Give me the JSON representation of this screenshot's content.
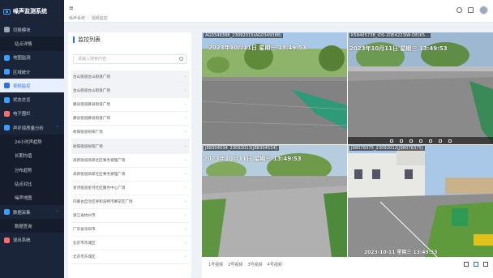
{
  "sidebar": {
    "brand": "噪声监测系统",
    "items": [
      {
        "label": "切换模块",
        "icon": "grid-icon",
        "color": "#9aa4b5",
        "kind": "top"
      },
      {
        "label": "站点详情",
        "kind": "sub"
      },
      {
        "label": "地图监测",
        "icon": "map-icon",
        "color": "#3aa0ff",
        "kind": "top"
      },
      {
        "label": "区域统计",
        "icon": "chart-icon",
        "color": "#3aa0ff",
        "kind": "top"
      },
      {
        "label": "视频监控",
        "icon": "camera-icon",
        "color": "#2f6fe0",
        "kind": "active"
      },
      {
        "label": "状态总览",
        "icon": "monitor-icon",
        "color": "#3aa0ff",
        "kind": "top"
      },
      {
        "label": "电子围栏",
        "icon": "fence-icon",
        "color": "#ff6b6b",
        "kind": "top"
      },
      {
        "label": "声环境质量分析",
        "icon": "wave-icon",
        "color": "#3aa0ff",
        "kind": "top",
        "caret": "⌃"
      },
      {
        "label": "24小时声趋势",
        "kind": "sub"
      },
      {
        "label": "长期均值",
        "kind": "sub"
      },
      {
        "label": "分布趋势",
        "kind": "sub"
      },
      {
        "label": "站点对比",
        "kind": "sub"
      },
      {
        "label": "噪声地图",
        "kind": "sub"
      },
      {
        "label": "数据采集",
        "icon": "data-icon",
        "color": "#3aa0ff",
        "kind": "top",
        "caret": "⌃"
      },
      {
        "label": "数据查询",
        "kind": "sub"
      },
      {
        "label": "退出系统",
        "icon": "logout-icon",
        "color": "#ff6b6b",
        "kind": "top"
      }
    ]
  },
  "header": {
    "menu_glyph": "≡",
    "breadcrumb": [
      "噪声系统",
      "视频监控"
    ],
    "breadcrumb_sep": "/"
  },
  "panel": {
    "title": "监控列表",
    "search_placeholder": "请输入搜索内容",
    "items": [
      {
        "label": "台山街道台山街道广场",
        "grey": true
      },
      {
        "label": "台山街道台山街道广场",
        "grey": true
      },
      {
        "label": "藤县街道藤县街道广场",
        "grey": false
      },
      {
        "label": "藤县街道藤县街道广场",
        "grey": false
      },
      {
        "label": "射阳街道射阳广场",
        "grey": false
      },
      {
        "label": "射阳街道射阳广场",
        "grey": true
      },
      {
        "label": "高新街道高新社区事务受理广场",
        "grey": false
      },
      {
        "label": "高新街道高新社区事务受理广场",
        "grey": false
      },
      {
        "label": "星河街道星河社区服务中心广场",
        "grey": false
      },
      {
        "label": "内蒙古自治区呼和浩特市赛罕区广场",
        "grey": false
      },
      {
        "label": "浙江省杭州市",
        "grey": false
      },
      {
        "label": "广东省深圳市",
        "grey": false
      },
      {
        "label": "北京市东城区",
        "grey": false
      },
      {
        "label": "北京市东城区",
        "grey": false
      }
    ],
    "chevron": "›"
  },
  "videos": {
    "cells": [
      {
        "label": "AG0349388_23092015(AG0349388)",
        "ts": "2023年10月11日 星期三 13:49:53"
      },
      {
        "label": "K58405738_iDS-2DE4223IW-DE(K5...",
        "ts": "2023年10月11日 星期三 13:49:53"
      },
      {
        "label": "J88304534_23092013(J88304534)",
        "ts": "2023年10月11日 星期三 13:49:53"
      },
      {
        "label": "J98078375_23092012(J98078375)",
        "ts": "2023-10-11 星期三 13:49:53"
      }
    ],
    "tabs": [
      "1号视频",
      "2号视频",
      "3号视频",
      "4号视频"
    ]
  }
}
